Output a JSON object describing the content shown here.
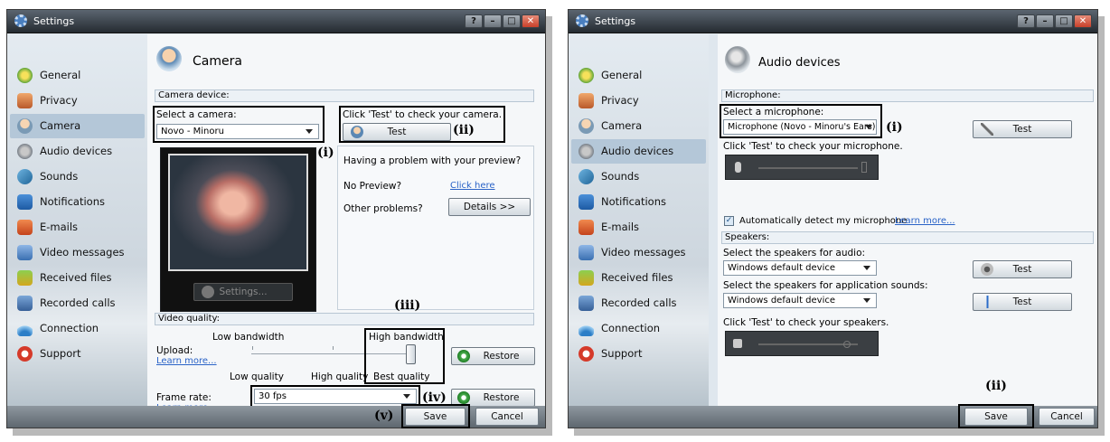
{
  "left_window": {
    "title": "Settings",
    "title_buttons": [
      "?",
      "–",
      "□",
      "✕"
    ],
    "sidebar": {
      "items": [
        {
          "label": "General",
          "icon": "general-icon"
        },
        {
          "label": "Privacy",
          "icon": "privacy-icon"
        },
        {
          "label": "Camera",
          "icon": "camera-icon",
          "selected": true
        },
        {
          "label": "Audio devices",
          "icon": "audio-devices-icon"
        },
        {
          "label": "Sounds",
          "icon": "sounds-icon"
        },
        {
          "label": "Notifications",
          "icon": "notifications-icon"
        },
        {
          "label": "E-mails",
          "icon": "emails-icon"
        },
        {
          "label": "Video messages",
          "icon": "video-messages-icon"
        },
        {
          "label": "Received files",
          "icon": "received-files-icon"
        },
        {
          "label": "Recorded calls",
          "icon": "recorded-calls-icon"
        },
        {
          "label": "Connection",
          "icon": "connection-icon"
        },
        {
          "label": "Support",
          "icon": "support-icon"
        }
      ]
    },
    "page_title": "Camera",
    "camera_device_section": "Camera device:",
    "select_camera_label": "Select a camera:",
    "camera_value": "Novo - Minoru",
    "test_hint": "Click 'Test' to check your camera.",
    "test_button": "Test",
    "problem_title": "Having a problem with your preview?",
    "no_preview_label": "No Preview?",
    "click_here_link": "Click here",
    "other_problems_label": "Other problems?",
    "details_button": "Details >>",
    "preview_settings_button": "Settings...",
    "video_quality_section": "Video quality:",
    "upload_label": "Upload:",
    "learn_more_link": "Learn more...",
    "low_bandwidth": "Low bandwidth",
    "high_bandwidth": "High bandwidth",
    "low_quality": "Low quality",
    "high_quality": "High quality",
    "best_quality": "Best quality",
    "upload_level": 1.0,
    "restore_button": "Restore",
    "frame_rate_label": "Frame rate:",
    "frame_rate_value": "30 fps",
    "save_button": "Save",
    "cancel_button": "Cancel",
    "annotations": {
      "i": "(i)",
      "ii": "(ii)",
      "iii": "(iii)",
      "iv": "(iv)",
      "v": "(v)"
    }
  },
  "right_window": {
    "title": "Settings",
    "title_buttons": [
      "?",
      "–",
      "□",
      "✕"
    ],
    "sidebar": {
      "items": [
        {
          "label": "General",
          "icon": "general-icon"
        },
        {
          "label": "Privacy",
          "icon": "privacy-icon"
        },
        {
          "label": "Camera",
          "icon": "camera-icon"
        },
        {
          "label": "Audio devices",
          "icon": "audio-devices-icon",
          "selected": true
        },
        {
          "label": "Sounds",
          "icon": "sounds-icon"
        },
        {
          "label": "Notifications",
          "icon": "notifications-icon"
        },
        {
          "label": "E-mails",
          "icon": "emails-icon"
        },
        {
          "label": "Video messages",
          "icon": "video-messages-icon"
        },
        {
          "label": "Received files",
          "icon": "received-files-icon"
        },
        {
          "label": "Recorded calls",
          "icon": "recorded-calls-icon"
        },
        {
          "label": "Connection",
          "icon": "connection-icon"
        },
        {
          "label": "Support",
          "icon": "support-icon"
        }
      ]
    },
    "page_title": "Audio devices",
    "microphone_section": "Microphone:",
    "select_mic_label": "Select a microphone:",
    "mic_value": "Microphone (Novo - Minoru's Ears)",
    "mic_test_button": "Test",
    "mic_hint": "Click 'Test' to check your microphone.",
    "auto_detect_label": "Automatically detect my microphone",
    "auto_detect_checked": true,
    "learn_more_link": "Learn more...",
    "speakers_section": "Speakers:",
    "select_speakers_label": "Select the speakers for audio:",
    "speakers_value": "Windows default device",
    "speakers_test_button": "Test",
    "select_app_sounds_label": "Select the speakers for application sounds:",
    "app_sounds_value": "Windows default device",
    "app_sounds_test_button": "Test",
    "speakers_hint": "Click 'Test' to check your speakers.",
    "save_button": "Save",
    "cancel_button": "Cancel",
    "annotations": {
      "i": "(i)",
      "ii": "(ii)"
    }
  },
  "colors": {
    "selected_item": "#b4c7d8",
    "link": "#2a63c7",
    "section_header": "#ecf1f6"
  }
}
